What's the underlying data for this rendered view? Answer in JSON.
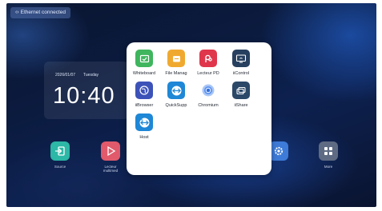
{
  "status_bar": {
    "network_label": "Ethernet connected",
    "icon": "code-brackets-icon"
  },
  "clock": {
    "date": "2026/01/07",
    "weekday": "Tuesday",
    "time": "10:40"
  },
  "dock": [
    {
      "label": "Source",
      "icon": "source-input-icon",
      "color": "#2cb7a6"
    },
    {
      "label": "Lecteur multimed",
      "icon": "media-play-icon",
      "color": "#e05a6b"
    },
    {
      "label": "",
      "icon": "gear-icon",
      "color": "#3e7bd8"
    },
    {
      "label": "More",
      "icon": "grid-more-icon",
      "color": "#5f6b83"
    }
  ],
  "app_drawer": {
    "apps": [
      {
        "label": "Whiteboard",
        "icon": "whiteboard-icon",
        "color": "#3fb55d"
      },
      {
        "label": "File Manag",
        "icon": "folder-icon",
        "color": "#f0a92f"
      },
      {
        "label": "Lecteur PD",
        "icon": "pdf-reader-icon",
        "color": "#e0364c"
      },
      {
        "label": "iiControl",
        "icon": "screen-control-icon",
        "color": "#27405f"
      },
      {
        "label": "iiBrowser",
        "icon": "globe-icon",
        "color": "#3d52b8"
      },
      {
        "label": "QuickSupp",
        "icon": "quicksupport-icon",
        "color": "#1e87d6"
      },
      {
        "label": "Chromium",
        "icon": "chromium-icon",
        "color": "#4f8ff2"
      },
      {
        "label": "iiShare",
        "icon": "share-screen-icon",
        "color": "#2b4868"
      },
      {
        "label": "Host",
        "icon": "host-icon",
        "color": "#1e87d6"
      }
    ]
  }
}
